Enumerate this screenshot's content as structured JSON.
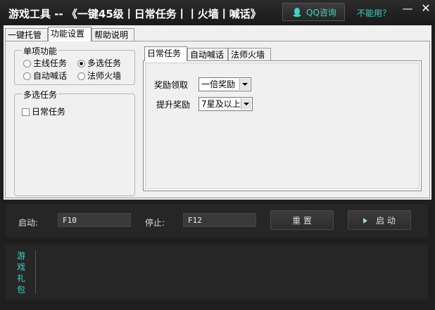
{
  "window": {
    "title": "游戏工具 -- 《一键45级丨日常任务丨丨火墙丨喊话》",
    "qq_button": "QQ咨询",
    "help_link": "不能用？",
    "minimize": "—",
    "close": "✕"
  },
  "outer_tabs": [
    "一键托管",
    "功能设置",
    "帮助说明"
  ],
  "single_group": {
    "title": "单项功能",
    "options": [
      {
        "label": "主线任务",
        "selected": false
      },
      {
        "label": "多选任务",
        "selected": true
      },
      {
        "label": "自动喊话",
        "selected": false
      },
      {
        "label": "法师火墙",
        "selected": false
      }
    ]
  },
  "multi_group": {
    "title": "多选任务",
    "checkbox": {
      "label": "日常任务",
      "checked": false
    }
  },
  "inner_tabs": [
    "日常任务",
    "自动喊话",
    "法师火墙"
  ],
  "daily": {
    "reward_label": "奖励领取",
    "reward_value": "一倍奖励",
    "upgrade_label": "提升奖励",
    "upgrade_value": "7星及以上"
  },
  "controls": {
    "start_label": "启动:",
    "start_key": "F10",
    "stop_label": "停止:",
    "stop_key": "F12",
    "reset_button": "重 置",
    "start_button": "启 动"
  },
  "gift": {
    "label": "游戏礼包"
  },
  "colors": {
    "accent": "#3ad6c4",
    "dark_bg": "#1f1f1f",
    "panel_bg": "#f0f0f0"
  },
  "icons": {
    "qq": "qq-penguin-icon",
    "start": "play-icon"
  }
}
